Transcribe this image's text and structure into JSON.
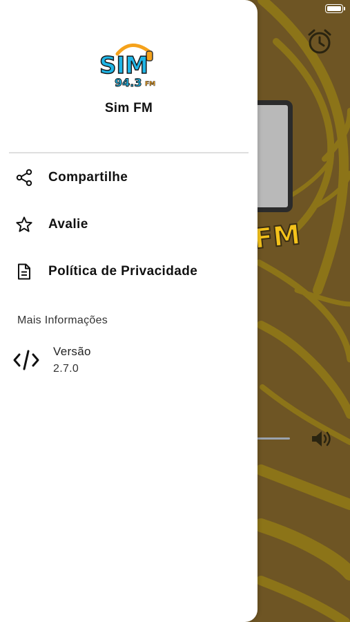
{
  "app": {
    "name": "Sim FM"
  },
  "logo": {
    "word": "SIM",
    "freq": "94.3",
    "band": "FM"
  },
  "menu": {
    "items": [
      {
        "label": "Compartilhe",
        "icon": "share-icon"
      },
      {
        "label": "Avalie",
        "icon": "star-icon"
      },
      {
        "label": "Política de Privacidade",
        "icon": "document-icon"
      }
    ]
  },
  "info": {
    "section_title": "Mais Informações",
    "version_label": "Versão",
    "version_value": "2.7.0",
    "version_icon": "code-icon"
  },
  "background": {
    "brand_fragment": "FM",
    "icons": [
      "alarm-clock-icon",
      "volume-icon",
      "battery-icon"
    ]
  },
  "colors": {
    "drawer_bg": "#ffffff",
    "background_brown": "#6e5524",
    "swirl_yellow": "#8a6f1e",
    "logo_blue": "#1fb5e6",
    "logo_orange": "#f5a21b"
  }
}
